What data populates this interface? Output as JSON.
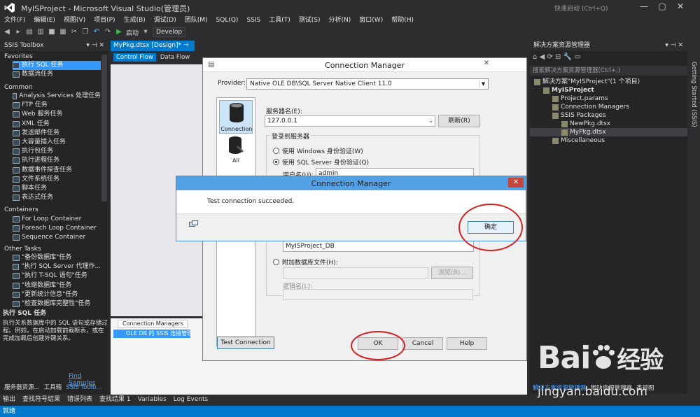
{
  "window": {
    "title": "MyISProject - Microsoft Visual Studio(管理员)",
    "quick_launch": "快速启动 (Ctrl+Q)"
  },
  "menu": [
    "文件(F)",
    "编辑(E)",
    "视图(V)",
    "项目(P)",
    "生成(B)",
    "调试(D)",
    "团队(M)",
    "SQL(Q)",
    "SSIS",
    "工具(T)",
    "测试(S)",
    "分析(N)",
    "窗口(W)",
    "帮助(H)"
  ],
  "toolbar": {
    "start": "启动",
    "config": "Develop"
  },
  "toolbox": {
    "title": "SSIS Toolbox",
    "favorites_title": "Favorites",
    "favorites": [
      "执行 SQL 任务",
      "数据流任务"
    ],
    "common_title": "Common",
    "common": [
      "Analysis Services 处理任务",
      "FTP 任务",
      "Web 服务任务",
      "XML 任务",
      "发送邮件任务",
      "大容量插入任务",
      "执行包任务",
      "执行进程任务",
      "数据事件探查任务",
      "文件系统任务",
      "脚本任务",
      "表达式任务"
    ],
    "containers_title": "Containers",
    "containers": [
      "For Loop Container",
      "Foreach Loop Container",
      "Sequence Container"
    ],
    "other_title": "Other Tasks",
    "other": [
      "\"备份数据库\"任务",
      "\"执行 SQL Server 代理作...",
      "\"执行 T-SQL 语句\"任务",
      "\"收缩数据库\"任务",
      "\"更新统计信息\"任务",
      "\"检查数据库完整性\"任务"
    ],
    "desc_title": "执行 SQL 任务",
    "desc_text": "执行关系数据库中的 SQL 语句或存储过程。例如，在启动加载前截断表，或在完成加载后创建外键关系。",
    "find_samples": "Find Samples",
    "tabs": [
      "服务器资源...",
      "工具箱",
      "SSIS Toolb..."
    ]
  },
  "document": {
    "tab": "MyPkg.dtsx [Design]*",
    "design_tabs": [
      "Control Flow",
      "Data Flow"
    ],
    "conn_managers_tab": "Connection Managers",
    "conn_item": "OLE DB 的 SSIS 连接管理器"
  },
  "solution": {
    "title": "解决方案资源管理器",
    "search": "搜索解决方案资源管理器(Ctrl+;)",
    "items": [
      {
        "label": "解决方案\"MyISProject\"(1 个项目)",
        "indent": 0
      },
      {
        "label": "MyISProject",
        "indent": 1
      },
      {
        "label": "Project.params",
        "indent": 2
      },
      {
        "label": "Connection Managers",
        "indent": 2
      },
      {
        "label": "SSIS Packages",
        "indent": 2
      },
      {
        "label": "NewPkg.dtsx",
        "indent": 3
      },
      {
        "label": "MyPkg.dtsx",
        "indent": 3
      },
      {
        "label": "Miscellaneous",
        "indent": 2
      }
    ],
    "tabs": [
      "解决方案资源管理器",
      "团队资源管理器",
      "类视图"
    ],
    "side_tab": "Getting Started (SSIS)"
  },
  "bottom_tabs": [
    "输出",
    "查找符号结果",
    "错误列表",
    "查找结果 1",
    "Variables",
    "Log Events"
  ],
  "status": "就绪",
  "conn_dialog": {
    "title": "Connection Manager",
    "provider_label": "Provider:",
    "provider_value": "Native OLE DB\\SQL Server Native Client 11.0",
    "side_connection": "Connection",
    "side_all": "All",
    "server_label": "服务器名(E):",
    "server_value": "127.0.0.1",
    "refresh": "刷新(R)",
    "login_group": "登录到服务器",
    "windows_auth": "使用 Windows 身份验证(W)",
    "sql_auth": "使用 SQL Server 身份验证(Q)",
    "username_label": "用户名(U):",
    "username_value": "admin",
    "db_value": "MyISProject_DB",
    "attach_db": "附加数据库文件(H):",
    "browse": "浏览(B)...",
    "logical_name": "逻辑名(L):",
    "test_connection": "Test Connection",
    "ok": "OK",
    "cancel": "Cancel",
    "help": "Help"
  },
  "success_dialog": {
    "title": "Connection Manager",
    "message": "Test connection succeeded.",
    "ok": "确定"
  },
  "watermark": {
    "brand": "Bai  经验",
    "url": "jingyan.baidu.com"
  }
}
